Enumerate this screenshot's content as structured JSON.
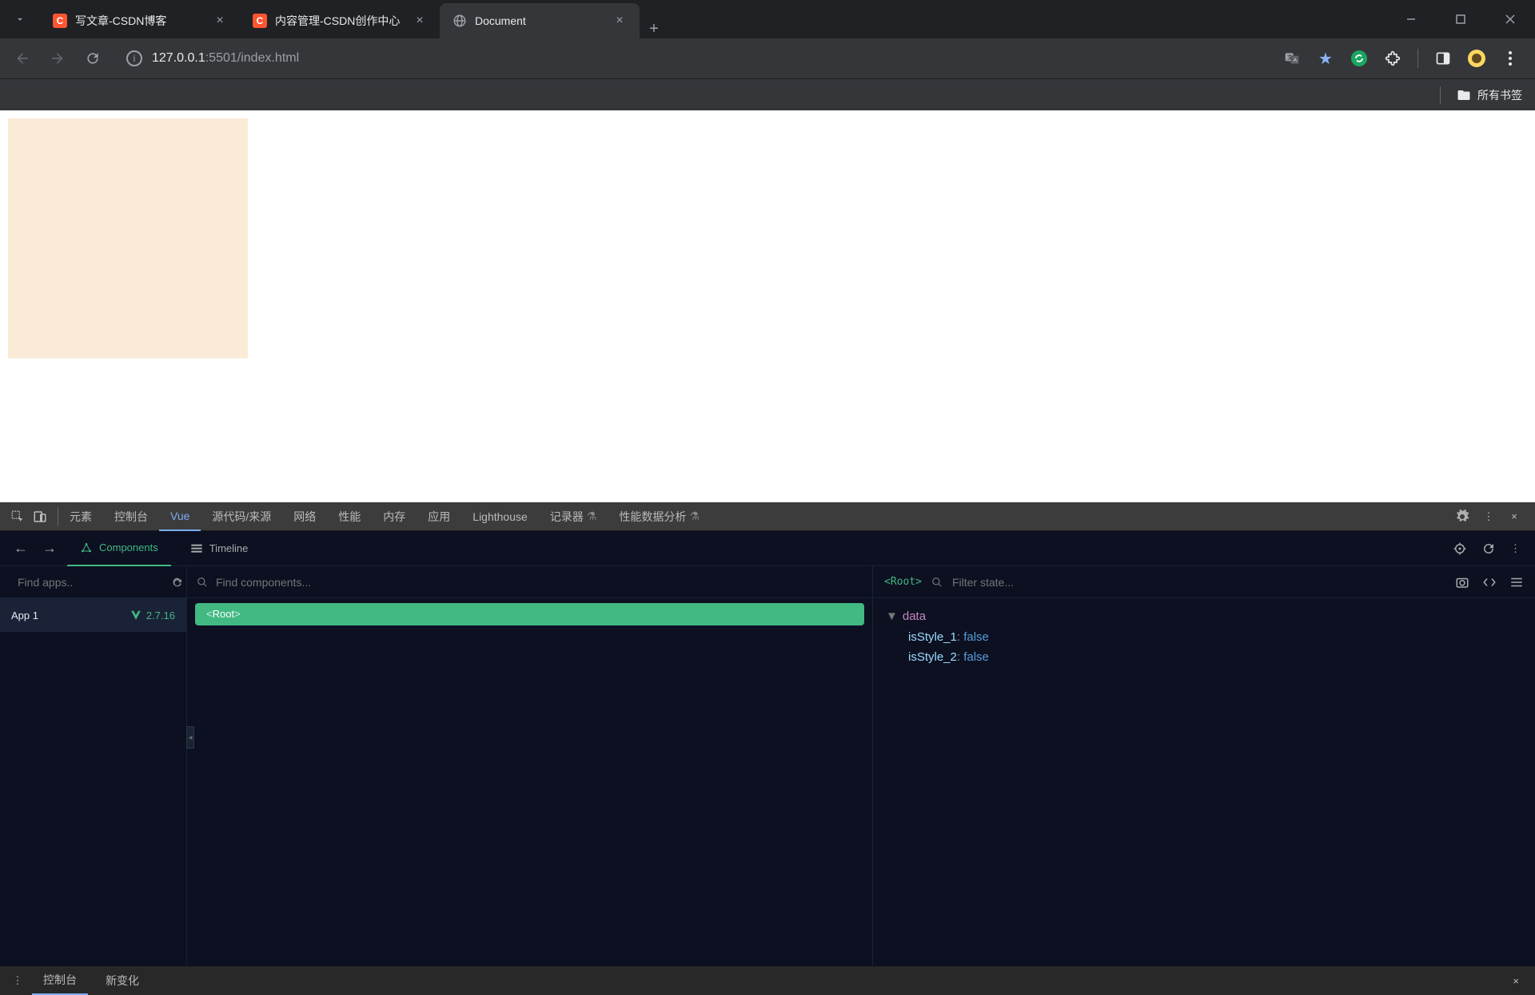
{
  "tabs": [
    {
      "title": "写文章-CSDN博客",
      "favicon": "csdn"
    },
    {
      "title": "内容管理-CSDN创作中心",
      "favicon": "csdn"
    },
    {
      "title": "Document",
      "favicon": "globe",
      "active": true
    }
  ],
  "url": {
    "host": "127.0.0.1",
    "port": ":5501",
    "path": "/index.html"
  },
  "bookmarks_label": "所有书签",
  "devtools": {
    "tabs": [
      "元素",
      "控制台",
      "Vue",
      "源代码/来源",
      "网络",
      "性能",
      "内存",
      "应用",
      "Lighthouse",
      "记录器",
      "性能数据分析"
    ],
    "active": "Vue",
    "experimental_tabs": [
      "记录器",
      "性能数据分析"
    ]
  },
  "vue": {
    "tabs": {
      "components": "Components",
      "timeline": "Timeline"
    },
    "find_apps_placeholder": "Find apps..",
    "find_components_placeholder": "Find components...",
    "filter_state_placeholder": "Filter state...",
    "app_name": "App 1",
    "vue_version": "2.7.16",
    "root_label": "<Root>",
    "state_root": "<Root>",
    "data_label": "data",
    "data": [
      {
        "key": "isStyle_1",
        "value": "false"
      },
      {
        "key": "isStyle_2",
        "value": "false"
      }
    ]
  },
  "drawer": {
    "tabs": [
      "控制台",
      "新变化"
    ],
    "active": "控制台"
  }
}
